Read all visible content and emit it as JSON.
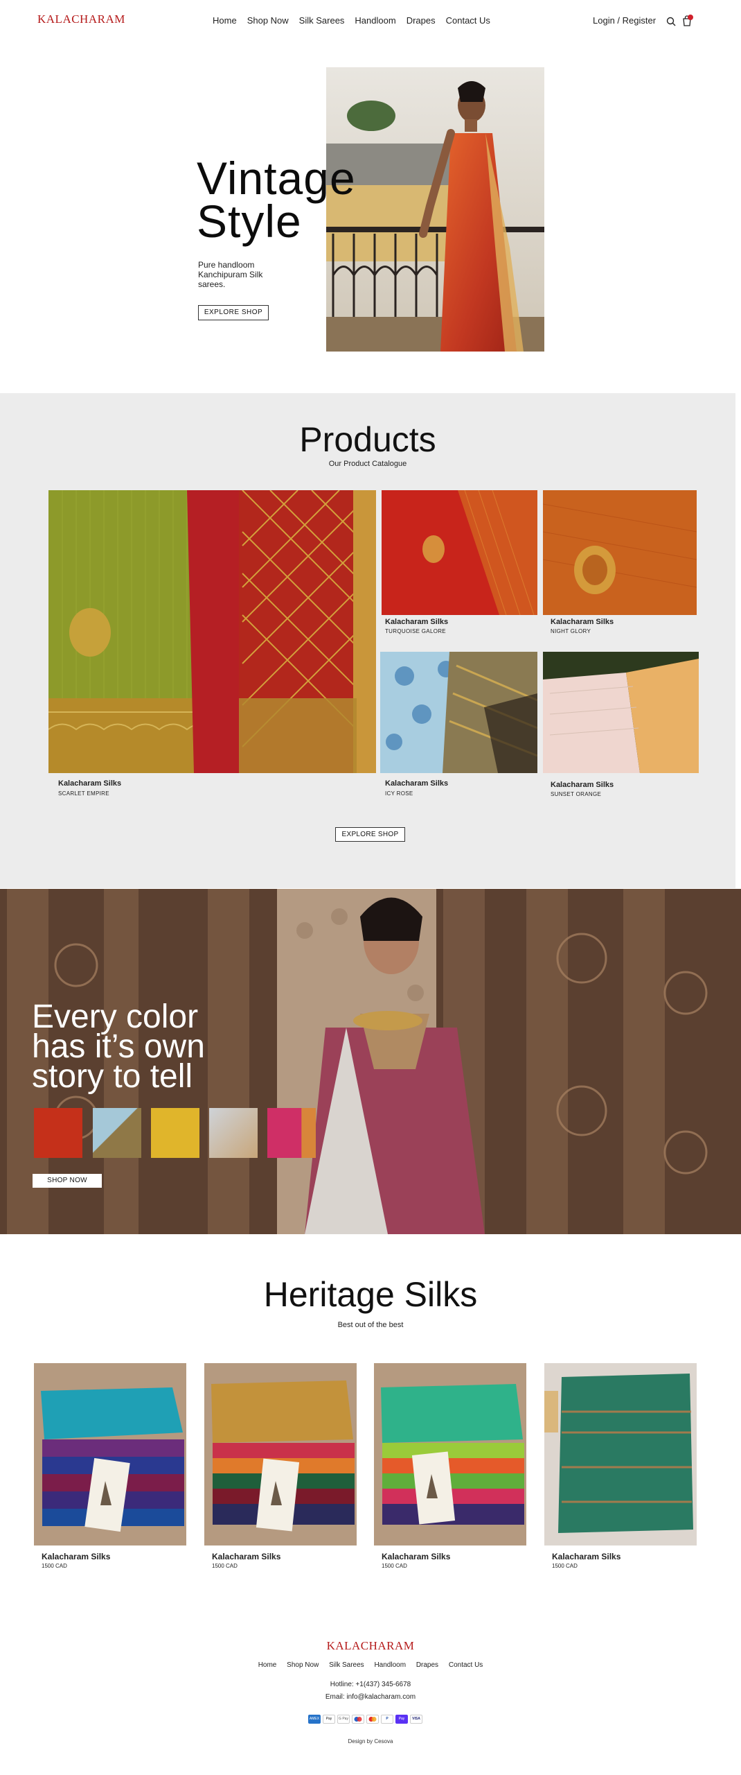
{
  "header": {
    "logo": "KALACHARAM",
    "nav": [
      "Home",
      "Shop Now",
      "Silk Sarees",
      "Handloom",
      "Drapes",
      "Contact Us"
    ],
    "login": "Login / Register"
  },
  "hero": {
    "title_line1": "Vintage",
    "title_line2": "Style",
    "subtitle": "Pure handloom Kanchipuram Silk sarees.",
    "button": "EXPLORE SHOP"
  },
  "products": {
    "title": "Products",
    "subtitle": "Our Product Catalogue",
    "items": [
      {
        "name": "Kalacharam Silks",
        "code": "SCARLET EMPIRE"
      },
      {
        "name": "Kalacharam Silks",
        "code": "TURQUOISE GALORE"
      },
      {
        "name": "Kalacharam Silks",
        "code": "NIGHT GLORY"
      },
      {
        "name": "Kalacharam Silks",
        "code": "ICY ROSE"
      },
      {
        "name": "Kalacharam Silks",
        "code": "SUNSET ORANGE"
      }
    ],
    "button": "EXPLORE SHOP"
  },
  "banner": {
    "line1": "Every color",
    "line2": "has it’s own",
    "line3": "story to tell",
    "button": "SHOP NOW"
  },
  "heritage": {
    "title": "Heritage Silks",
    "subtitle": "Best out of the best",
    "items": [
      {
        "name": "Kalacharam Silks",
        "price": "1500 CAD"
      },
      {
        "name": "Kalacharam Silks",
        "price": "1500 CAD"
      },
      {
        "name": "Kalacharam Silks",
        "price": "1500 CAD"
      },
      {
        "name": "Kalacharam Silks",
        "price": "1500 CAD"
      }
    ]
  },
  "footer": {
    "logo": "KALACHARAM",
    "nav": [
      "Home",
      "Shop Now",
      "Silk Sarees",
      "Handloom",
      "Drapes",
      "Contact Us"
    ],
    "hotline": "Hotline: +1(437) 345-6678",
    "email": "Email: info@kalacharam.com",
    "payments": [
      "AMEX",
      "Pay",
      "G Pay",
      "",
      "",
      "P",
      "Pay",
      "VISA"
    ],
    "design": "Design by Cesova"
  },
  "colors": {
    "brand": "#b51a1a",
    "products_bg": "#ececec"
  }
}
